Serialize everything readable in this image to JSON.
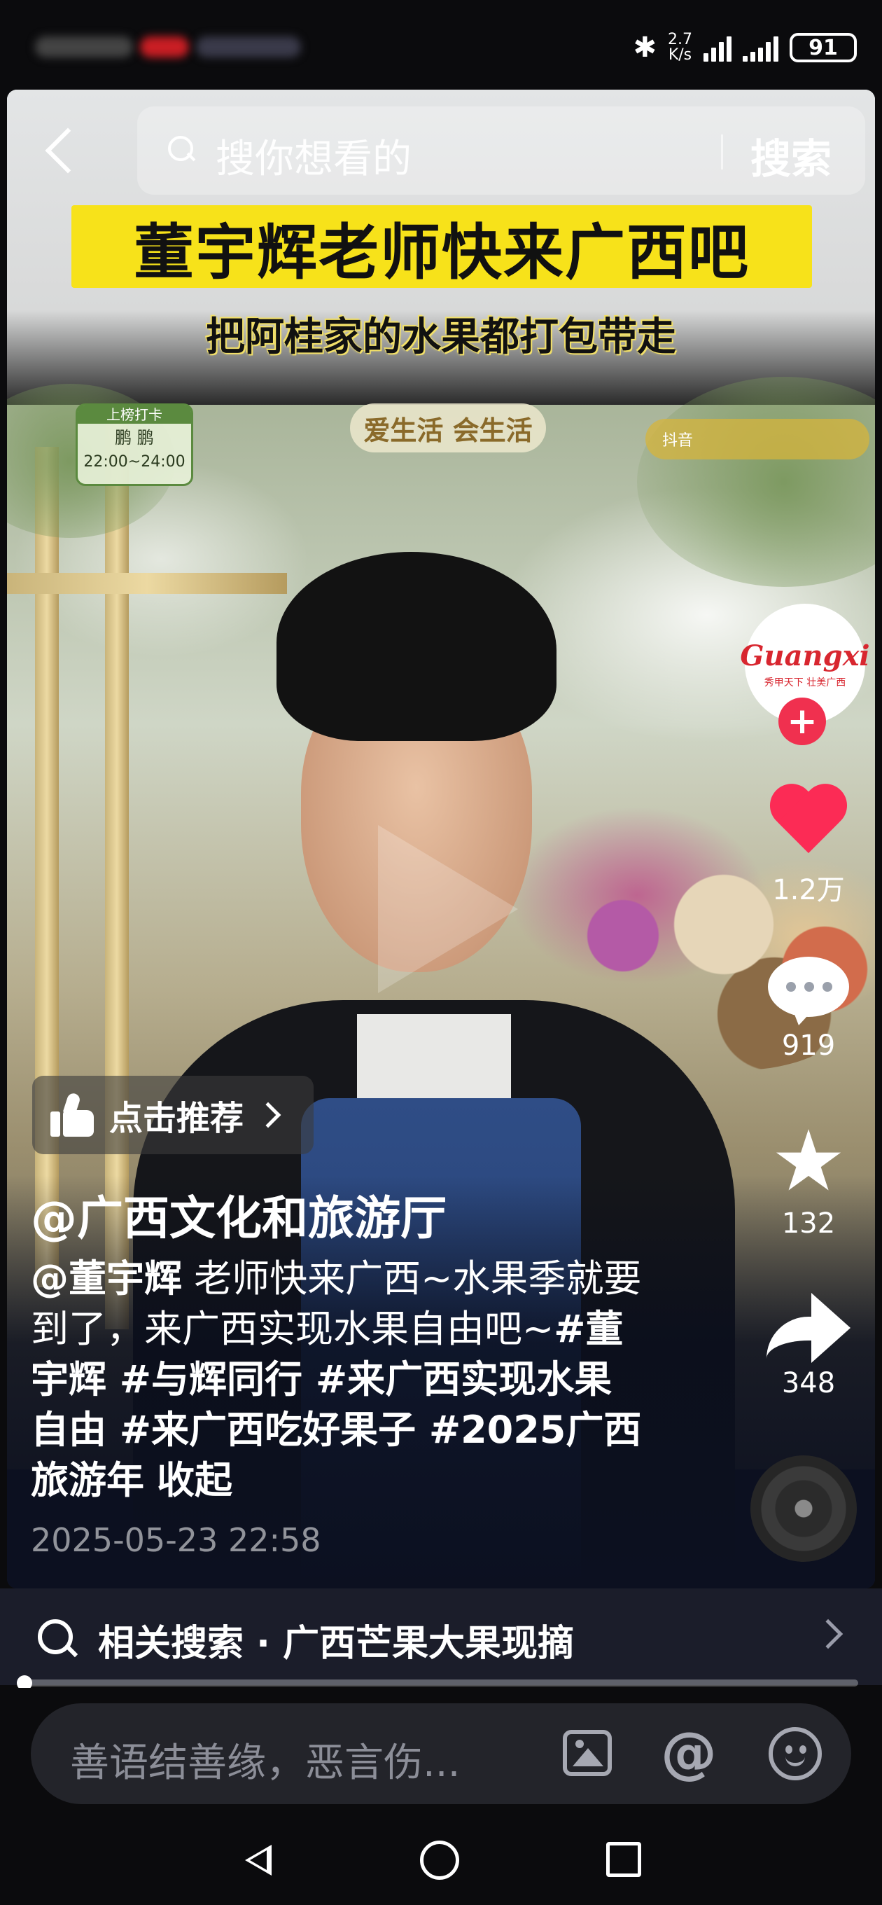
{
  "status_bar": {
    "net_speed_value": "2.7",
    "net_speed_unit": "K/s",
    "battery": "91",
    "bluetooth_symbol": "✱"
  },
  "search": {
    "placeholder": "搜你想看的",
    "button_label": "搜索"
  },
  "video_overlay": {
    "banner_title": "董宇辉老师快来广西吧",
    "banner_subtitle": "把阿桂家的水果都打包带走",
    "schedule_tag": "上榜打卡",
    "schedule_name": "鹏 鹏",
    "schedule_time": "22:00~24:00",
    "show_slogan": "爱生活 会生活",
    "corner_logo": "抖音"
  },
  "author": {
    "avatar_brand": "Guangxi",
    "avatar_subtitle": "秀甲天下 壮美广西",
    "follow_symbol": "+"
  },
  "actions": {
    "likes": "1.2万",
    "comments": "919",
    "favorites": "132",
    "shares": "348"
  },
  "post": {
    "recommend_label": "点击推荐",
    "account_name": "@广西文化和旅游厅",
    "caption_mention": "@董宇辉",
    "caption_body": " 老师快来广西~水果季就要到了，来广西实现水果自由吧~",
    "caption_tags": "#董宇辉 #与辉同行 #来广西实现水果自由 #来广西吃好果子 #2025广西旅游年",
    "collapse_label": "收起",
    "date": "2025-05-23 22:58"
  },
  "related_search": {
    "text": "相关搜索 · 广西芒果大果现摘"
  },
  "playback": {
    "progress": 0.0
  },
  "comment_box": {
    "placeholder": "善语结善缘，恶言伤..."
  },
  "icons": {
    "at_symbol": "@",
    "star_symbol": "★"
  },
  "colors": {
    "like_red": "#fc2b55",
    "follow_red": "#f0304f",
    "banner_yellow": "#f7e21a"
  }
}
